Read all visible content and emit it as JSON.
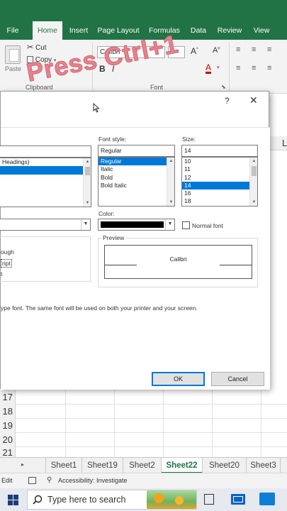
{
  "ribbon_tabs": [
    "File",
    "Home",
    "Insert",
    "Page Layout",
    "Formulas",
    "Data",
    "Review",
    "View"
  ],
  "ribbon": {
    "paste_label": "Paste",
    "cut_label": "Cut",
    "copy_label": "Copy",
    "clipboard_group": "Clipboard",
    "font_name": "Calibri",
    "font_group": "Font"
  },
  "overlay_text": "Press Ctrl+1",
  "dialog": {
    "help": "?",
    "close": "✕",
    "font_style_label": "Font style:",
    "font_style_value": "Regular",
    "font_styles": [
      "Regular",
      "Italic",
      "Bold",
      "Bold Italic"
    ],
    "size_label": "Size:",
    "size_value": "14",
    "sizes": [
      "10",
      "11",
      "12",
      "14",
      "16",
      "18"
    ],
    "font_list_fragment": "Headings)",
    "color_label": "Color:",
    "normal_font_label": "Normal font",
    "preview_label": "Preview",
    "preview_text": "Calibri",
    "effects_fragment_1": "ough",
    "effects_fragment_2": "ript",
    "effects_fragment_3": "t",
    "info_text": "ype font.  The same font will be used on both your printer and your screen.",
    "ok_label": "OK",
    "cancel_label": "Cancel"
  },
  "column_fragment": "L",
  "row_numbers": [
    "17",
    "18",
    "19",
    "20",
    "21"
  ],
  "sheet_nav": "▸",
  "sheet_tabs": [
    "Sheet1",
    "Sheet19",
    "Sheet2",
    "Sheet22",
    "Sheet20",
    "Sheet3"
  ],
  "active_sheet": "Sheet22",
  "status": {
    "mode": "Edit",
    "accessibility": "Accessibility: Investigate"
  },
  "taskbar": {
    "search_placeholder": "Type here to search"
  },
  "colors": {
    "excel_green": "#217346",
    "selection_blue": "#0078d7",
    "overlay_pink": "#e5828d"
  }
}
